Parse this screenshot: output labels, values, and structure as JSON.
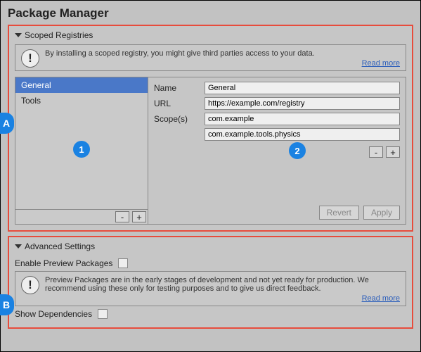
{
  "title": "Package Manager",
  "callouts": {
    "A": "A",
    "B": "B",
    "one": "1",
    "two": "2"
  },
  "scoped": {
    "header": "Scoped Registries",
    "info": "By installing a scoped registry, you might give third parties access to your data.",
    "read_more": "Read more",
    "list": [
      "General",
      "Tools"
    ],
    "minus": "-",
    "plus": "+",
    "form": {
      "name_label": "Name",
      "name_value": "General",
      "url_label": "URL",
      "url_value": "https://example.com/registry",
      "scopes_label": "Scope(s)",
      "scope_values": [
        "com.example",
        "com.example.tools.physics"
      ]
    },
    "revert": "Revert",
    "apply": "Apply"
  },
  "advanced": {
    "header": "Advanced Settings",
    "enable_preview": "Enable Preview Packages",
    "info": "Preview Packages are in the early stages of development and not yet ready for production. We recommend using these only for testing purposes and to give us direct feedback.",
    "read_more": "Read more",
    "show_deps": "Show Dependencies"
  }
}
